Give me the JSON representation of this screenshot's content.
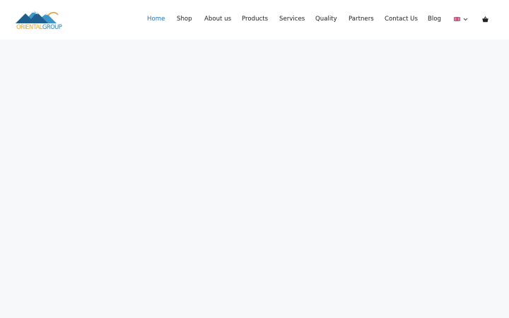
{
  "brand": {
    "logo_word1": "ORIENTAL",
    "logo_word2": "GROUP",
    "colors": {
      "mountain_dark": "#1f5f8f",
      "mountain_light": "#3f95c8",
      "sun": "#e0a33a"
    }
  },
  "nav": {
    "items": [
      {
        "label": "Home",
        "active": true
      },
      {
        "label": "Shop"
      },
      {
        "label": "About us"
      },
      {
        "label": "Products"
      },
      {
        "label": "Services"
      },
      {
        "label": "Quality"
      },
      {
        "label": "Partners"
      },
      {
        "label": "Contact Us"
      },
      {
        "label": "Blog"
      }
    ],
    "language_icon": "uk-flag-icon",
    "dropdown_icon": "chevron-down-icon",
    "cart_icon": "shopping-basket-icon"
  },
  "colors": {
    "active_link": "#1e73be",
    "link": "#222222",
    "header_bg": "#ffffff",
    "page_bg": "#f7f8f9"
  }
}
